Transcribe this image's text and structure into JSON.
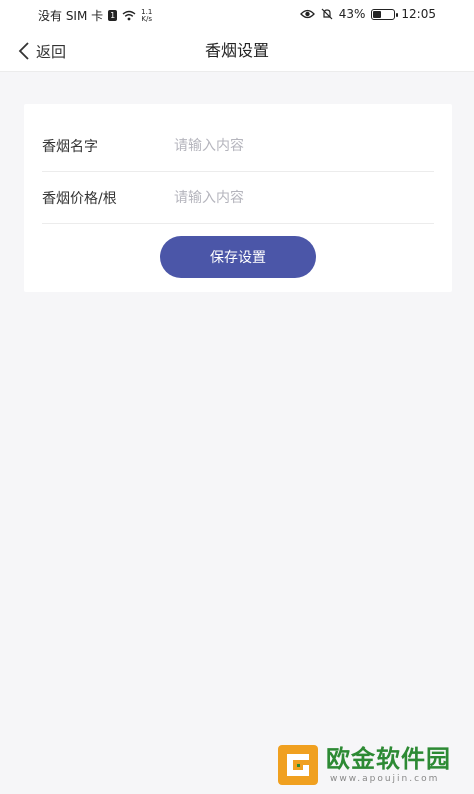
{
  "status_bar": {
    "carrier": "没有 SIM 卡",
    "sim_badge": "1",
    "net_speed": "1.1",
    "net_speed_unit": "K/s",
    "battery": "43%",
    "time": "12:05"
  },
  "navbar": {
    "back_label": "返回",
    "title": "香烟设置"
  },
  "form": {
    "name_label": "香烟名字",
    "name_placeholder": "请输入内容",
    "name_value": "",
    "price_label": "香烟价格/根",
    "price_placeholder": "请输入内容",
    "price_value": "",
    "save_label": "保存设置"
  },
  "colors": {
    "accent": "#4b56a8",
    "background": "#f6f6f8",
    "watermark_green": "#2d8a34",
    "watermark_orange": "#f0a020"
  },
  "watermark": {
    "text_cn": "欧金软件园",
    "text_en": "www.apoujin.com"
  }
}
